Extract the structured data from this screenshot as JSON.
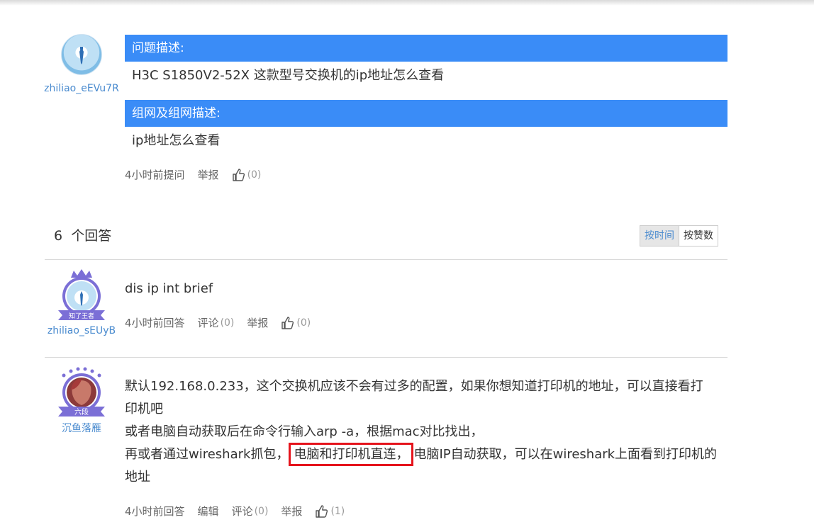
{
  "question": {
    "author": "zhiliao_eEVu7R",
    "section1_title": "问题描述:",
    "section1_text": "H3C S1850V2-52X 这款型号交换机的ip地址怎么查看",
    "section2_title": "组网及组网描述:",
    "section2_text": "ip地址怎么查看",
    "time": "4小时前提问",
    "report": "举报",
    "likes": "(0)"
  },
  "answers_header": {
    "count": "6",
    "label": "个回答",
    "sort_time": "按时间",
    "sort_likes": "按赞数"
  },
  "answers": [
    {
      "author": "zhiliao_sEUyB",
      "badge": "知了王者",
      "text": "dis ip int brief",
      "time": "4小时前回答",
      "comment": "评论",
      "comment_count": "(0)",
      "report": "举报",
      "likes": "(0)"
    },
    {
      "author": "沉鱼落雁",
      "badge": "六段",
      "line1": "默认192.168.0.233，这个交换机应该不会有过多的配置，如果你想知道打印机的地址，可以直接看打",
      "line2": "印机吧",
      "line3": "或者电脑自动获取后在命令行输入arp -a，根据mac对比找出，",
      "line4_before": "再或者通过wireshark抓包，",
      "line4_highlight": "电脑和打印机直连，",
      "line4_after": "电脑IP自动获取，可以在wireshark上面看到打印机的",
      "line5": "地址",
      "time": "4小时前回答",
      "edit": "编辑",
      "comment": "评论",
      "comment_count": "(0)",
      "report": "举报",
      "likes": "(1)"
    }
  ],
  "colors": {
    "header_blue": "#3a8cf7",
    "link_blue": "#4a8bcf",
    "highlight_red": "#e5141c"
  }
}
